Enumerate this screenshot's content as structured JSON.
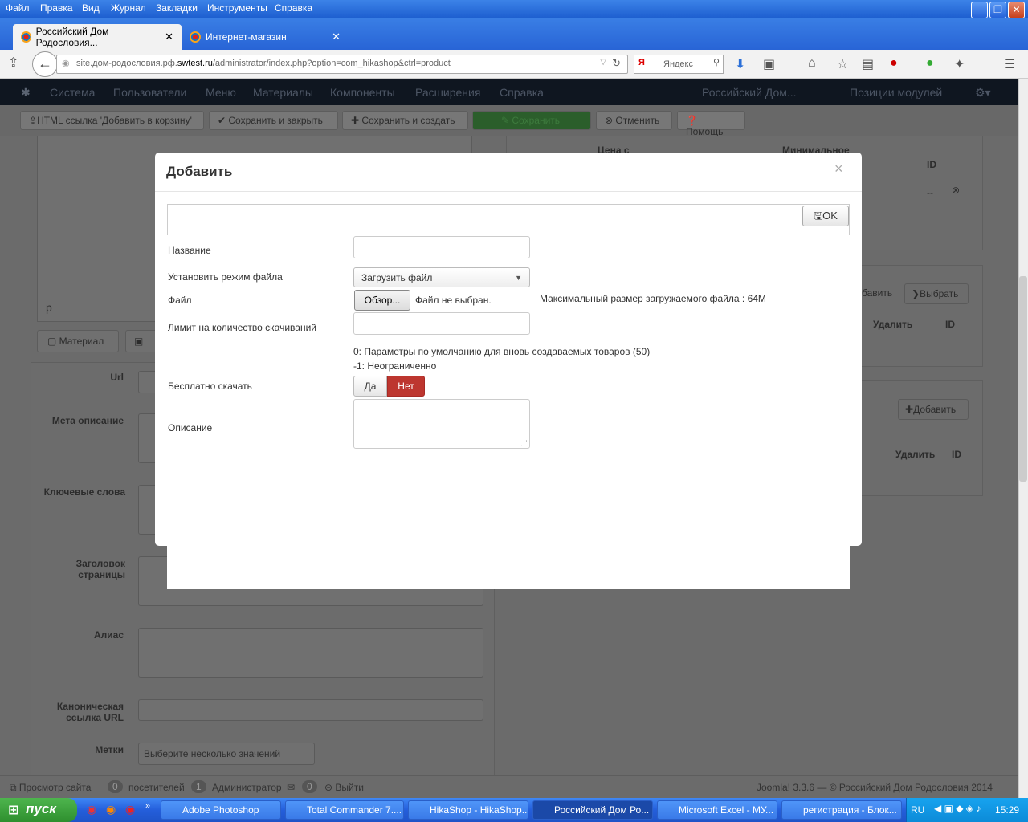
{
  "menu": [
    "Файл",
    "Правка",
    "Вид",
    "Журнал",
    "Закладки",
    "Инструменты",
    "Справка"
  ],
  "tabs": [
    {
      "title": "Российский Дом Родословия...",
      "active": true
    },
    {
      "title": "Интернет-магазин",
      "active": false
    }
  ],
  "url": {
    "host": "site.дом-родословия.рф.",
    "domain": "swtest.ru",
    "path": "/administrator/index.php?option=com_hikashop&ctrl=product"
  },
  "search_placeholder": "Яндекс",
  "joomla_nav": [
    "Система",
    "Пользователи",
    "Меню",
    "Материалы",
    "Компоненты",
    "Расширения",
    "Справка"
  ],
  "joomla_site": "Российский Дом...",
  "joomla_positions": "Позиции модулей",
  "toolbar": {
    "html_link": "HTML ссылка 'Добавить в корзину'",
    "save_close": "Сохранить и закрыть",
    "save_new": "Сохранить и создать",
    "save": "Сохранить",
    "cancel": "Отменить",
    "help": "Помощь"
  },
  "left_labels": {
    "url": "Url",
    "meta_desc": "Мета описание",
    "keywords": "Ключевые слова",
    "page_title": "Заголовок страницы",
    "alias": "Алиас",
    "canonical": "Каноническая ссылка URL",
    "tags": "Метки",
    "tags_placeholder": "Выберите несколько значений",
    "material_btn": "Материал",
    "editor_p": "p"
  },
  "right_panel": {
    "price_from": "Цена с",
    "min_qty": "Минимальное",
    "id": "ID",
    "dash": "--",
    "choose": "Выбрать",
    "add": "Добавить",
    "add_partial": "бавить",
    "delete": "Удалить"
  },
  "status": {
    "view_site": "Просмотр сайта",
    "visitors_count": "0",
    "visitors": "посетителей",
    "admins_count": "1",
    "admins": "Администратор",
    "messages_count": "0",
    "logout": "Выйти",
    "copyright": "Joomla! 3.3.6 — © Российский Дом Родословия 2014"
  },
  "modal": {
    "title": "Добавить",
    "close": "×",
    "ok": "OK",
    "name_label": "Название",
    "mode_label": "Установить режим файла",
    "mode_value": "Загрузить файл",
    "file_label": "Файл",
    "browse": "Обзор...",
    "no_file": "Файл не выбран.",
    "max_size": "Максимальный размер загружаемого файла : 64M",
    "limit_label": "Лимит на количество скачиваний",
    "hint1": "0: Параметры по умолчанию для вновь создаваемых товаров (50)",
    "hint2": "-1: Неограниченно",
    "free_label": "Бесплатно скачать",
    "yes": "Да",
    "no": "Нет",
    "desc_label": "Описание"
  },
  "taskbar": {
    "start": "пуск",
    "items": [
      "Adobe Photoshop",
      "Total Commander 7....",
      "HikaShop - HikaShop...",
      "Российский Дом Ро...",
      "Microsoft Excel - МУ...",
      "регистрация - Блок..."
    ],
    "lang": "RU",
    "time": "15:29"
  }
}
